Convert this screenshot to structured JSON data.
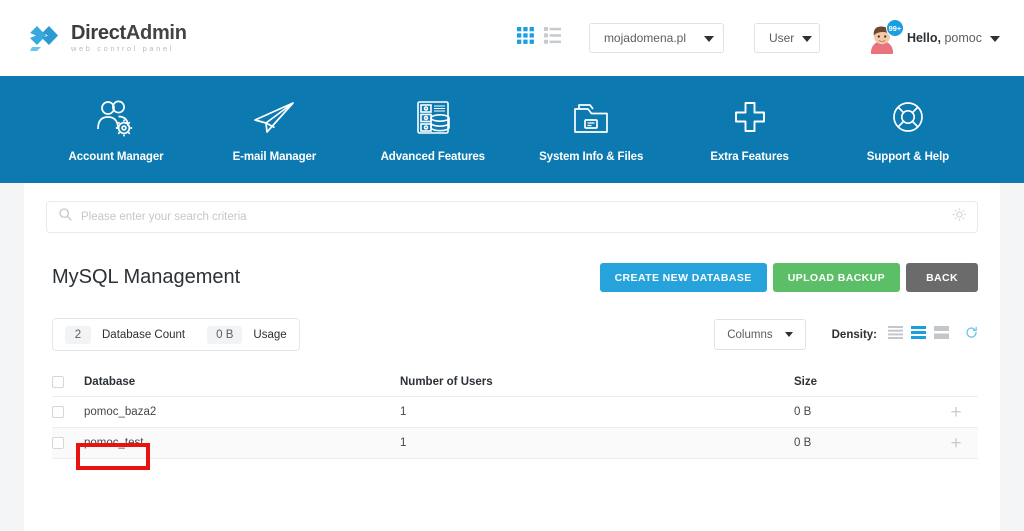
{
  "header": {
    "brand_name_bold": "Direct",
    "brand_name_light": "Admin",
    "brand_sub": "web control panel",
    "logo_icon": "double-chevron-logo",
    "grid_view_icon": "grid-view-icon",
    "list_view_icon": "list-view-icon",
    "domain_select": {
      "value": "mojadomena.pl",
      "icon": "chevron-down-icon"
    },
    "user_select": {
      "value": "User",
      "icon": "chevron-down-icon"
    },
    "avatar_icon": "user-avatar",
    "notification_badge": "99+",
    "greeting_bold": "Hello,",
    "greeting_name": "pomoc",
    "greeting_caret_icon": "chevron-down-icon"
  },
  "nav": {
    "items": [
      {
        "label": "Account Manager",
        "icon": "users-gear-icon"
      },
      {
        "label": "E-mail Manager",
        "icon": "paper-plane-icon"
      },
      {
        "label": "Advanced Features",
        "icon": "database-server-icon"
      },
      {
        "label": "System Info & Files",
        "icon": "folder-icon"
      },
      {
        "label": "Extra Features",
        "icon": "plus-icon"
      },
      {
        "label": "Support & Help",
        "icon": "lifebuoy-icon"
      }
    ]
  },
  "search": {
    "placeholder": "Please enter your search criteria",
    "value": "",
    "search_icon": "search-icon",
    "settings_icon": "gear-icon"
  },
  "main": {
    "title": "MySQL Management",
    "buttons": [
      {
        "label": "CREATE NEW DATABASE",
        "color": "#27a3dc"
      },
      {
        "label": "UPLOAD BACKUP",
        "color": "#5cbf67"
      },
      {
        "label": "BACK",
        "color": "#6b6b6b"
      }
    ],
    "stats": {
      "count_value": "2",
      "count_label": "Database Count",
      "usage_value": "0 B",
      "usage_label": "Usage"
    },
    "toolbar": {
      "columns_label": "Columns",
      "columns_icon": "chevron-down-icon",
      "density_label": "Density:",
      "density_options": [
        {
          "name": "density-compact-icon",
          "active": false
        },
        {
          "name": "density-standard-icon",
          "active": true
        },
        {
          "name": "density-comfortable-icon",
          "active": false
        }
      ],
      "refresh_icon": "refresh-icon"
    },
    "table": {
      "select_all_icon": "checkbox-unchecked",
      "headers": [
        "Database",
        "Number of Users",
        "Size"
      ],
      "rows": [
        {
          "checkbox_icon": "checkbox-unchecked",
          "database": "pomoc_baza2",
          "users": "1",
          "size": "0 B",
          "expand_icon": "plus-icon",
          "highlighted": false
        },
        {
          "checkbox_icon": "checkbox-unchecked",
          "database": "pomoc_test",
          "users": "1",
          "size": "0 B",
          "expand_icon": "plus-icon",
          "highlighted": true
        }
      ]
    }
  },
  "annotation": {
    "target": "pomoc_test",
    "color": "#e8130f",
    "shape": "rectangle-outline"
  },
  "colors": {
    "nav_blue": "#0c7ab0",
    "accent_blue": "#27a3dc",
    "green": "#5cbf67",
    "gray": "#6b6b6b",
    "page_bg": "#f4f5f6"
  }
}
